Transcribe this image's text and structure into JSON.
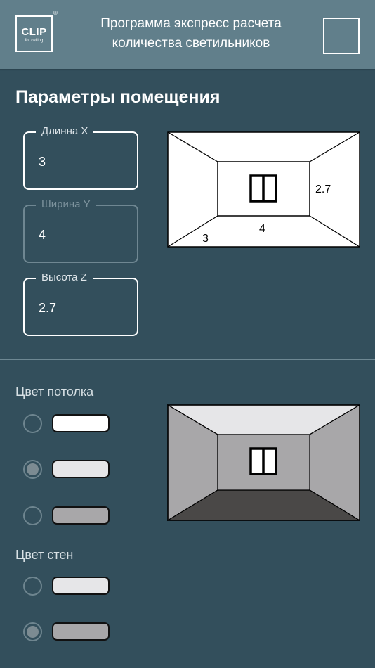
{
  "header": {
    "logo_main": "CLIP",
    "logo_sub": "for ceiling",
    "logo_reg": "®",
    "title_line1": "Программа экспресс расчета",
    "title_line2": "количества светильников"
  },
  "room_params": {
    "title": "Параметры помещения",
    "length": {
      "label": "Длинна X",
      "value": "3"
    },
    "width": {
      "label": "Ширина Y",
      "value": "4"
    },
    "height": {
      "label": "Высота Z",
      "value": "2.7"
    }
  },
  "diagram": {
    "height_label": "2.7",
    "width_label": "4",
    "length_label": "3"
  },
  "ceiling_color": {
    "title": "Цвет потолка",
    "options": [
      {
        "color": "#ffffff",
        "selected": false
      },
      {
        "color": "#e6e6e8",
        "selected": true
      },
      {
        "color": "#a8a7a9",
        "selected": false
      }
    ]
  },
  "wall_color": {
    "title": "Цвет стен",
    "options": [
      {
        "color": "#e6e6e8",
        "selected": false
      },
      {
        "color": "#a8a7a9",
        "selected": true
      }
    ]
  },
  "preview_colors": {
    "ceiling": "#e6e6e8",
    "side_walls": "#a8a7a9",
    "back_wall": "#a8a7a9",
    "floor": "#4a4847",
    "window": "#ffffff"
  }
}
